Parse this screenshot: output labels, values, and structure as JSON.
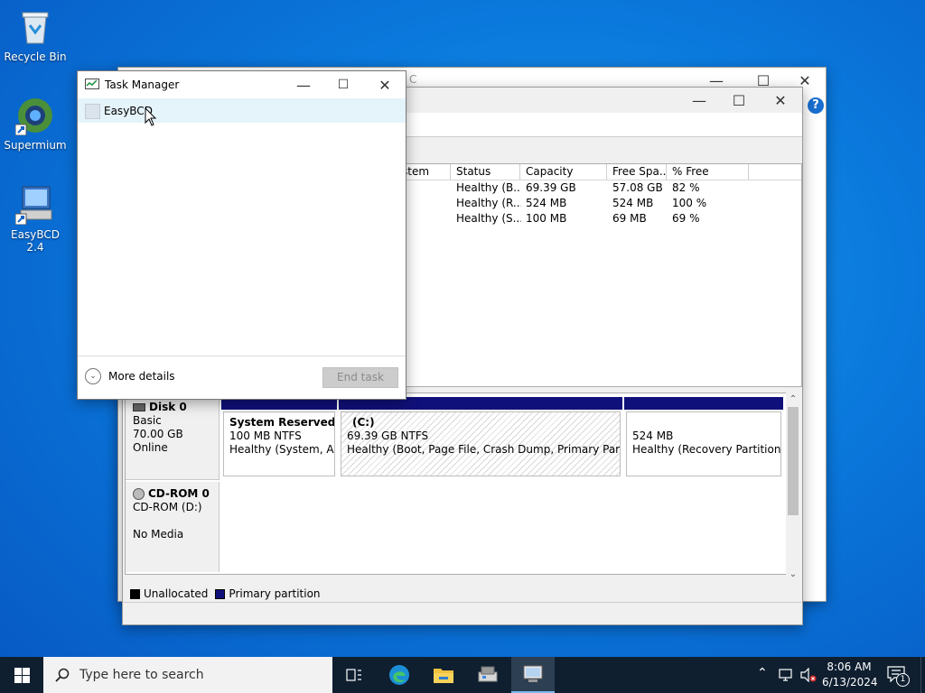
{
  "desktop": {
    "icons": [
      {
        "label": "Recycle Bin",
        "icon": "recycle-bin-icon"
      },
      {
        "label": "Supermium",
        "icon": "supermium-icon"
      },
      {
        "label": "EasyBCD 2.4",
        "icon": "easybcd-icon"
      }
    ]
  },
  "disk_mgmt": {
    "title_partial": "C",
    "columns": [
      "stem",
      "Status",
      "Capacity",
      "Free Spa...",
      "% Free"
    ],
    "rows": [
      {
        "status": "Healthy (B...",
        "capacity": "69.39 GB",
        "free": "57.08 GB",
        "pct": "82 %"
      },
      {
        "status": "Healthy (R...",
        "capacity": "524 MB",
        "free": "524 MB",
        "pct": "100 %"
      },
      {
        "status": "Healthy (S...",
        "capacity": "100 MB",
        "free": "69 MB",
        "pct": "69 %"
      }
    ],
    "disk0": {
      "name": "Disk 0",
      "type": "Basic",
      "size": "70.00 GB",
      "state": "Online",
      "partitions": [
        {
          "name": "System Reserved",
          "size": "100 MB NTFS",
          "status": "Healthy (System, Acti"
        },
        {
          "name": "(C:)",
          "size": "69.39 GB NTFS",
          "status": "Healthy (Boot, Page File, Crash Dump, Primary Partition)"
        },
        {
          "name": "",
          "size": "524 MB",
          "status": "Healthy (Recovery Partition)"
        }
      ]
    },
    "cdrom0": {
      "name": "CD-ROM 0",
      "drive": "CD-ROM (D:)",
      "media": "No Media"
    },
    "legend": {
      "unallocated": "Unallocated",
      "primary": "Primary partition"
    },
    "colors": {
      "primary": "#10107a",
      "unallocated": "#000000"
    }
  },
  "task_manager": {
    "title": "Task Manager",
    "apps": [
      {
        "name": "EasyBCD"
      }
    ],
    "more_details": "More details",
    "end_task": "End task"
  },
  "taskbar": {
    "search_placeholder": "Type here to search",
    "time": "8:06 AM",
    "date": "6/13/2024",
    "notification_count": "1",
    "pinned": [
      "task-view-icon",
      "edge-icon",
      "file-explorer-icon",
      "easybcd-taskbar-icon",
      "disk-management-taskbar-icon"
    ]
  }
}
